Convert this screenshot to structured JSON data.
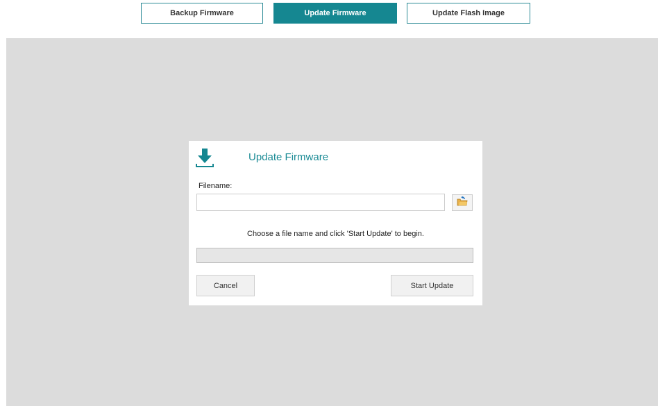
{
  "tabs": [
    {
      "label": "Backup Firmware",
      "active": false
    },
    {
      "label": "Update Firmware",
      "active": true
    },
    {
      "label": "Update Flash Image",
      "active": false
    }
  ],
  "dialog": {
    "icon": "download-icon",
    "title": "Update Firmware",
    "filename_label": "Filename:",
    "filename_value": "",
    "filename_placeholder": "",
    "browse_icon": "open-folder-icon",
    "status_text": "Choose a file name and click 'Start Update' to begin.",
    "progress_fraction": 0,
    "cancel_label": "Cancel",
    "start_label": "Start Update"
  },
  "colors": {
    "accent": "#158791",
    "stage_background": "#dcdcdc"
  }
}
